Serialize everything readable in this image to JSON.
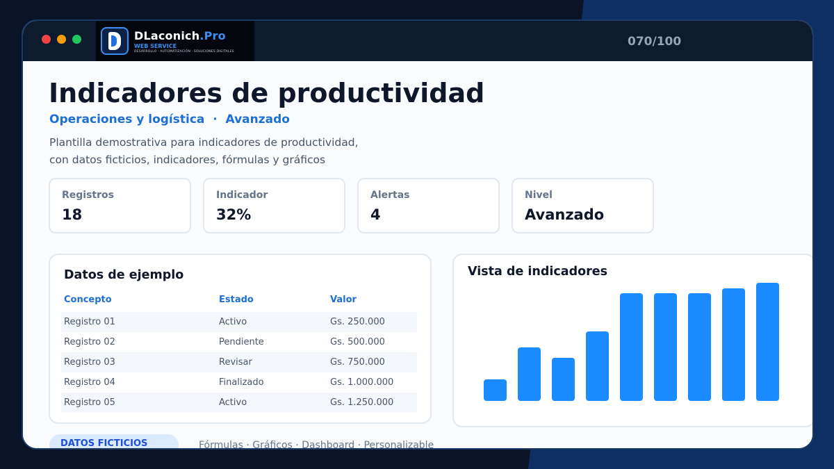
{
  "counter": "070/100",
  "brand": {
    "name": "DLaconich",
    "name_suffix": ".Pro",
    "sub": "WEB SERVICE",
    "tagline": "DESARROLLO · AUTOMATIZACIÓN · SOLUCIONES DIGITALES"
  },
  "header": {
    "title": "Indicadores de productividad",
    "subtitle": "Operaciones y logística  ·  Avanzado",
    "description_line1": "Plantilla demostrativa para indicadores de productividad,",
    "description_line2": "con datos ficticios, indicadores, fórmulas y gráficos"
  },
  "kpis": [
    {
      "label": "Registros",
      "value": "18"
    },
    {
      "label": "Indicador",
      "value": "32%"
    },
    {
      "label": "Alertas",
      "value": "4"
    },
    {
      "label": "Nivel",
      "value": "Avanzado"
    }
  ],
  "table": {
    "title": "Datos de ejemplo",
    "columns": [
      "Concepto",
      "Estado",
      "Valor"
    ],
    "rows": [
      [
        "Registro 01",
        "Activo",
        "Gs. 250.000"
      ],
      [
        "Registro 02",
        "Pendiente",
        "Gs. 500.000"
      ],
      [
        "Registro 03",
        "Revisar",
        "Gs. 750.000"
      ],
      [
        "Registro 04",
        "Finalizado",
        "Gs. 1.000.000"
      ],
      [
        "Registro 05",
        "Activo",
        "Gs. 1.250.000"
      ]
    ]
  },
  "chart_data": {
    "type": "bar",
    "title": "Vista de indicadores",
    "values": [
      20,
      50,
      40,
      65,
      100,
      100,
      100,
      105,
      110
    ],
    "ylim": [
      0,
      110
    ],
    "grid": false,
    "color": "#1a8cff"
  },
  "footer": {
    "badge": "DATOS FICTICIOS",
    "text": "Fórmulas · Gráficos · Dashboard · Personalizable"
  },
  "colors": {
    "accent": "#1d6fd1",
    "bar": "#1a8cff",
    "dark": "#0e1a2e"
  }
}
